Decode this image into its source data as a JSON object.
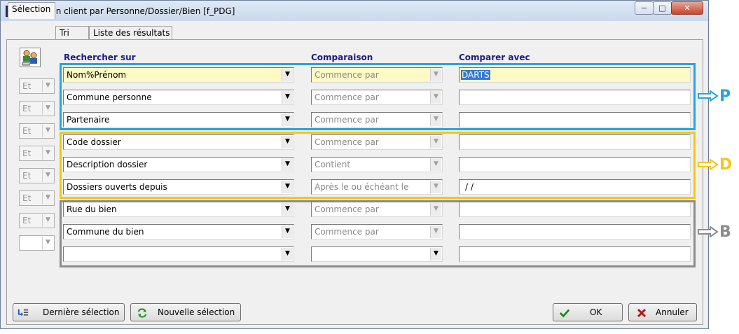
{
  "window": {
    "title": "Sélection client par Personne/Dossier/Bien [f_PDG]",
    "controls": {
      "minimize": "−",
      "maximize": "□",
      "close": "✕"
    }
  },
  "tabs": [
    {
      "label": "Sélection",
      "active": true
    },
    {
      "label": "Tri",
      "active": false
    },
    {
      "label": "Liste des résultats",
      "active": false
    }
  ],
  "headers": {
    "search_on": "Rechercher sur",
    "comparison": "Comparaison",
    "compare_with": "Comparer avec"
  },
  "logic_ops": [
    "Et",
    "Et",
    "Et",
    "Et",
    "Et",
    "Et",
    "Et",
    ""
  ],
  "rows": [
    {
      "field": "Nom%Prénom",
      "comparison": "Commence par",
      "value": "DARTS",
      "value_selected": true,
      "highlighted": true
    },
    {
      "field": "Commune personne",
      "comparison": "Commence par",
      "value": ""
    },
    {
      "field": "Partenaire",
      "comparison": "Commence par",
      "value": ""
    },
    {
      "field": "Code dossier",
      "comparison": "Commence par",
      "value": ""
    },
    {
      "field": "Description dossier",
      "comparison": "Contient",
      "value": ""
    },
    {
      "field": "Dossiers ouverts depuis",
      "comparison": "Après le ou échéant le",
      "value": " /  /"
    },
    {
      "field": "Rue du bien",
      "comparison": "Commence par",
      "value": ""
    },
    {
      "field": "Commune du bien",
      "comparison": "Commence par",
      "value": ""
    },
    {
      "field": "",
      "comparison": "",
      "value": ""
    }
  ],
  "groups": [
    {
      "letter": "P",
      "color": "#29a3e0"
    },
    {
      "letter": "D",
      "color": "#f5c518"
    },
    {
      "letter": "B",
      "color": "#8c8c8c"
    }
  ],
  "buttons": {
    "last_selection": "Dernière sélection",
    "new_selection": "Nouvelle sélection",
    "ok": "OK",
    "cancel": "Annuler"
  },
  "icons": {
    "app": "app-icon",
    "filter": "people-filter-icon",
    "last_selection": "list-arrow-icon",
    "new_selection": "refresh-icon",
    "ok": "checkmark-icon",
    "cancel": "x-icon"
  }
}
